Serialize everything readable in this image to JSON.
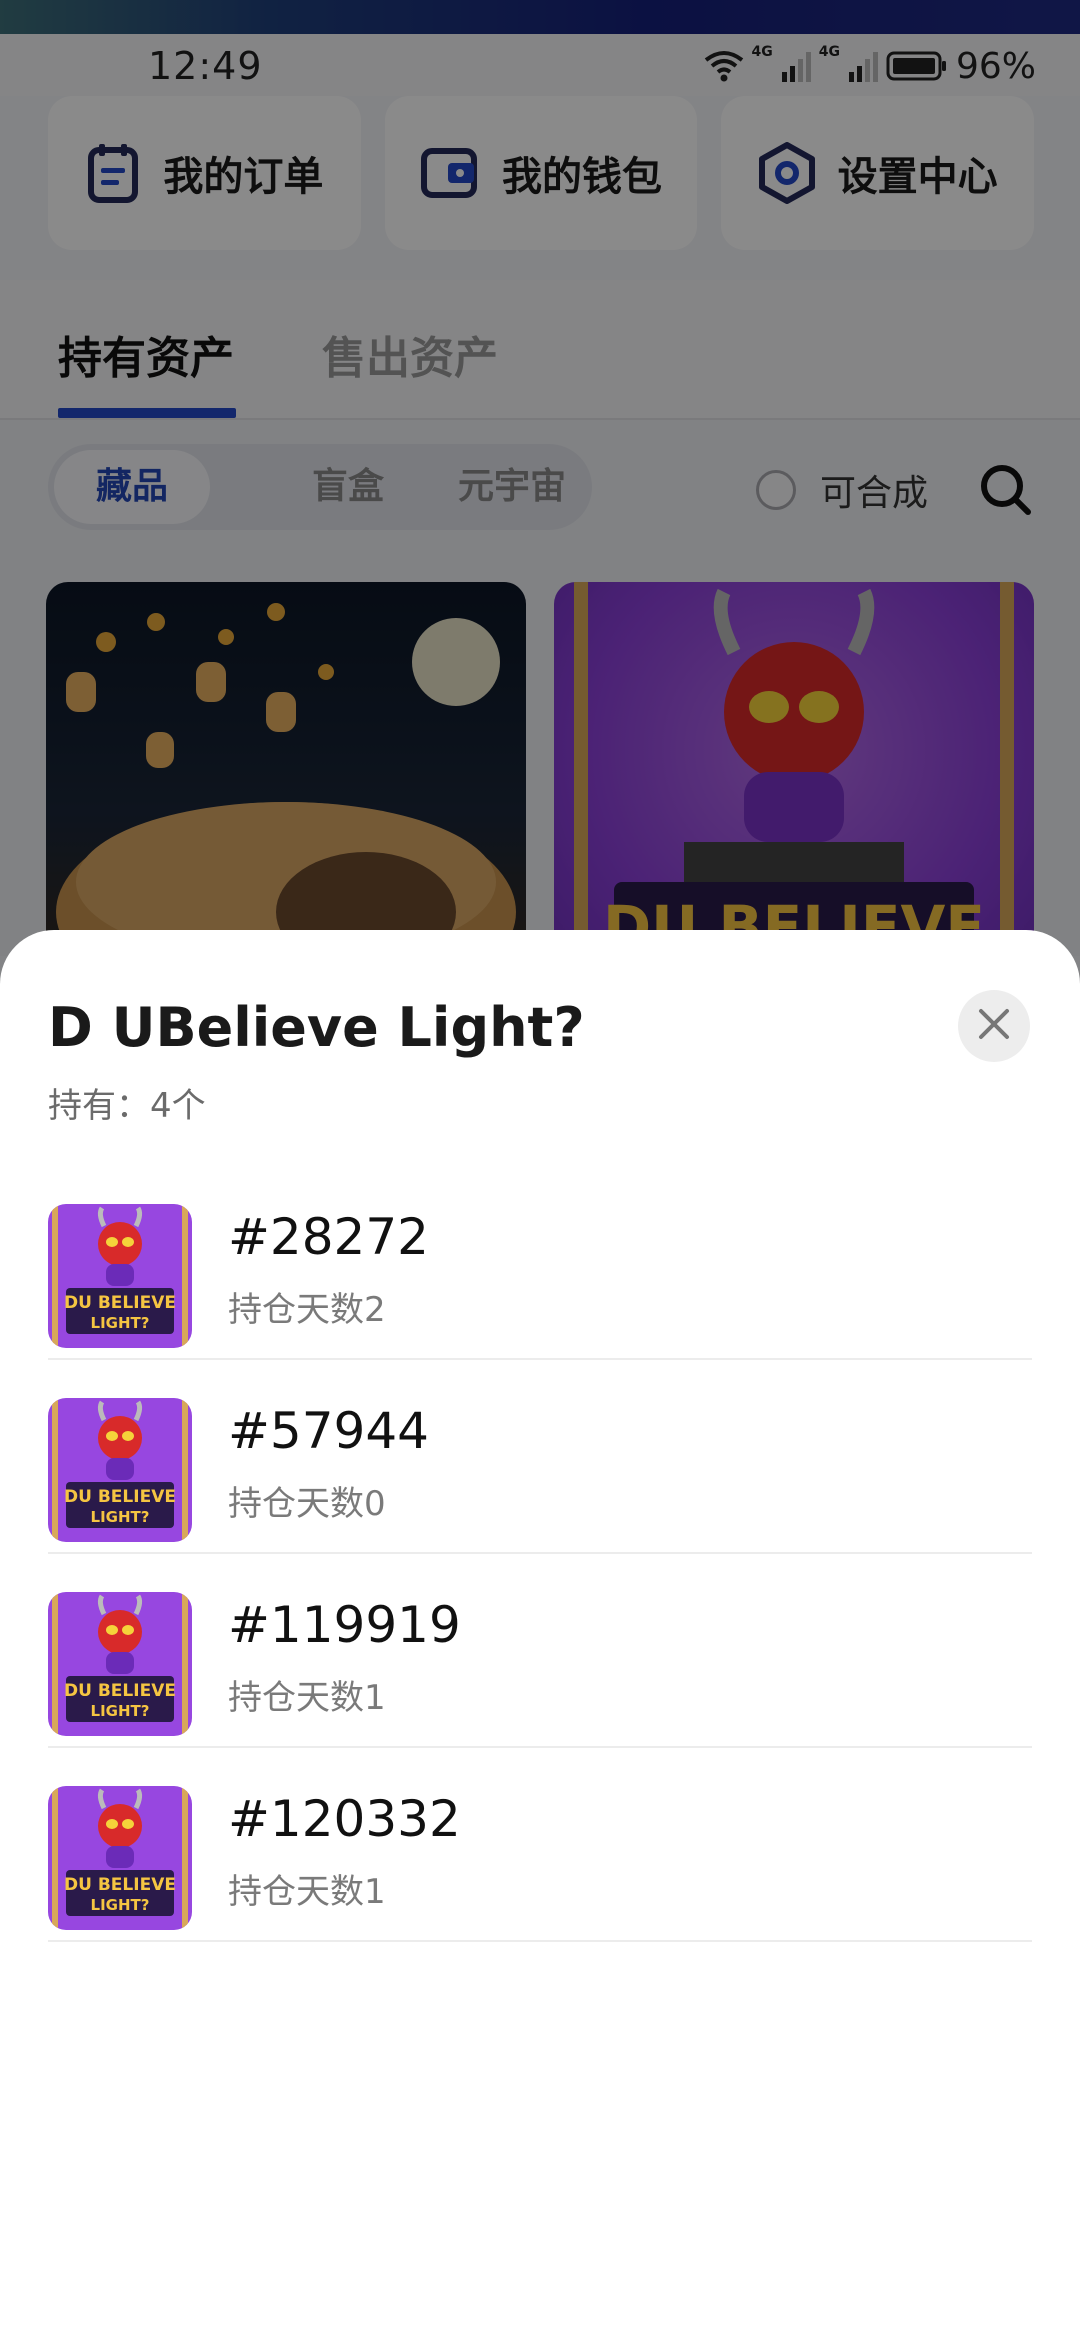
{
  "status": {
    "time": "12:49",
    "network": [
      "4G",
      "4G"
    ],
    "battery": "96%"
  },
  "quick_actions": [
    {
      "label": "我的订单",
      "icon": "order-icon"
    },
    {
      "label": "我的钱包",
      "icon": "wallet-icon"
    },
    {
      "label": "设置中心",
      "icon": "settings-hexagon-icon"
    }
  ],
  "tabs": {
    "active": "持有资产",
    "inactive": "售出资产"
  },
  "filters": {
    "segments": [
      "藏品",
      "盲盒",
      "元宇宙"
    ],
    "toggle_label": "可合成"
  },
  "sheet": {
    "title": "D UBelieve Light?",
    "holding": "持有：4个",
    "items": [
      {
        "id": "#28272",
        "days": "持仓天数2"
      },
      {
        "id": "#57944",
        "days": "持仓天数0"
      },
      {
        "id": "#119919",
        "days": "持仓天数1"
      },
      {
        "id": "#120332",
        "days": "持仓天数1"
      }
    ]
  },
  "colors": {
    "accent": "#2449c8",
    "sheet_bg": "#ffffff",
    "thumb_purple": "#8b3fd9"
  }
}
